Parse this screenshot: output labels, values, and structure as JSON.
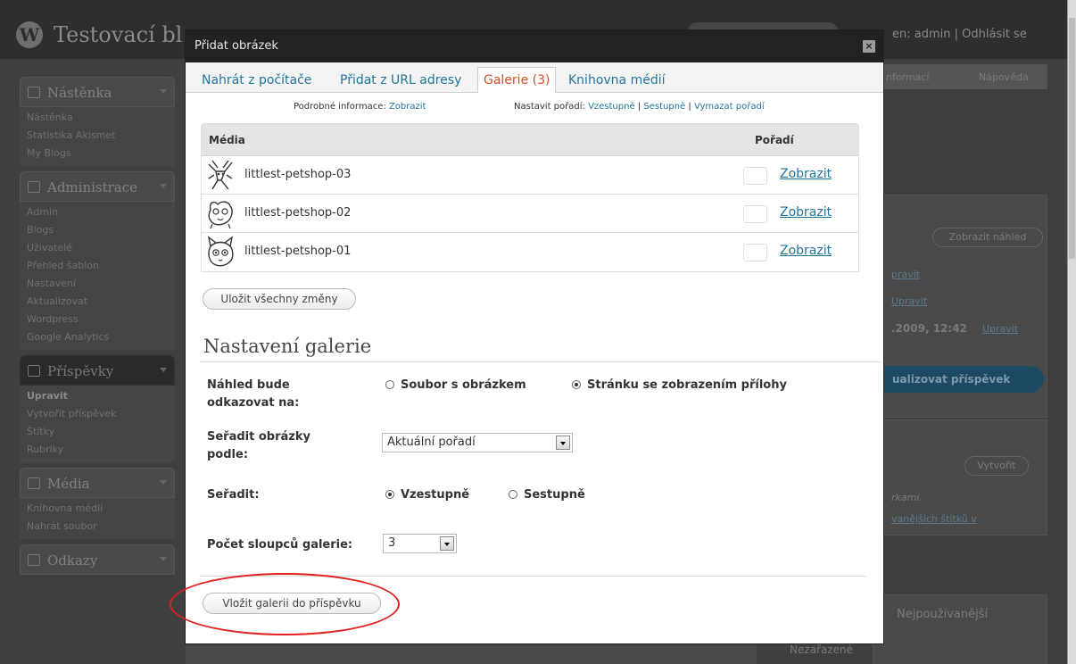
{
  "background": {
    "site_title": "Testovací bl",
    "user_greeting": "en: admin | Odhlásit se",
    "sidebar": {
      "dashboard_heading": "Nástěnka",
      "dashboard_items": [
        "Nástěnka",
        "Statistika Akismet",
        "My Blogs"
      ],
      "admin_heading": "Administrace",
      "admin_items": [
        "Admin",
        "Blogs",
        "Uživatelé",
        "Přehled šablon",
        "Nastavení",
        "Aktualizovat",
        "Wordpress",
        "Google Analytics"
      ],
      "posts_heading": "Příspěvky",
      "posts_items": [
        "Upravit",
        "Vytvořit příspěvek",
        "Štítky",
        "Rubriky"
      ],
      "media_heading": "Média",
      "media_items": [
        "Knihovna médií",
        "Nahrát soubor"
      ],
      "links_heading": "Odkazy"
    },
    "right": {
      "tab_info": "nformací",
      "tab_help": "Nápověda",
      "preview_button": "Zobrazit náhled",
      "edit_link_1": "pravit",
      "edit_link_2": "Upravit",
      "date_text": ".2009, 12:42",
      "edit_link_3": "Upravit",
      "update_button": "ualizovat příspěvek",
      "create_button": "Vytvořit",
      "tags_hint": "rkami.",
      "tags_link": "vanějších štítků v",
      "most_used": "Nejpoužívanější",
      "uncategorized": "Nezařazené"
    }
  },
  "dialog": {
    "title": "Přidat obrázek",
    "close_glyph": "×",
    "tabs": [
      {
        "label": "Nahrát z počítače"
      },
      {
        "label": "Přidat z URL adresy"
      },
      {
        "label": "Galerie (3)",
        "active": true
      },
      {
        "label": "Knihovna médií"
      }
    ],
    "details_label": "Podrobné informace:",
    "details_link": "Zobrazit",
    "order_label": "Nastavit pořadí:",
    "order_asc": "Vzestupně",
    "order_desc": "Sestupně",
    "order_clear": "Vymazat pořadí",
    "separator": "|",
    "table": {
      "col_media": "Média",
      "col_order": "Pořadí",
      "rows": [
        {
          "name": "littlest-petshop-03",
          "action": "Zobrazit",
          "icon": "sketch-figure-icon"
        },
        {
          "name": "littlest-petshop-02",
          "action": "Zobrazit",
          "icon": "sketch-dog-icon"
        },
        {
          "name": "littlest-petshop-01",
          "action": "Zobrazit",
          "icon": "sketch-cat-icon"
        }
      ]
    },
    "save_all_button": "Uložit všechny změny",
    "gallery_settings_heading": "Nastavení galerie",
    "link_to_label": "Náhled bude odkazovat na:",
    "link_to_options": [
      {
        "label": "Soubor s obrázkem",
        "checked": false
      },
      {
        "label": "Stránku se zobrazením přílohy",
        "checked": true
      }
    ],
    "orderby_label": "Seřadit obrázky podle:",
    "orderby_value": "Aktuální pořadí",
    "order_dir_label": "Seřadit:",
    "order_dir_options": [
      {
        "label": "Vzestupně",
        "checked": true
      },
      {
        "label": "Sestupně",
        "checked": false
      }
    ],
    "columns_label": "Počet sloupců galerie:",
    "columns_value": "3",
    "insert_button": "Vložit galerii do příspěvku"
  },
  "annotation_color": "#e21d1d",
  "link_color": "#21759b",
  "active_tab_color": "#d54e21"
}
